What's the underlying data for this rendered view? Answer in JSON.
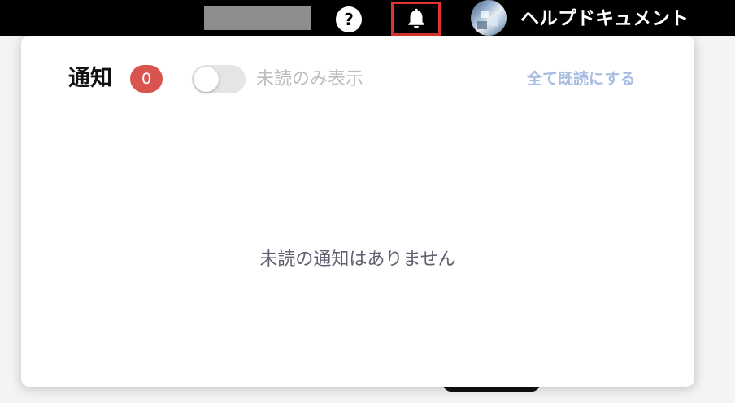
{
  "topbar": {
    "help_icon_glyph": "?",
    "help_icon": "question-circle-icon",
    "bell_icon": "bell-icon",
    "help_document_label": "ヘルプドキュメント",
    "highlight_color": "#e3342f"
  },
  "notifications": {
    "title": "通知",
    "count": "0",
    "badge_color": "#d9534f",
    "unread_only_label": "未読のみ表示",
    "unread_only_enabled": false,
    "mark_all_read_label": "全て既読にする",
    "mark_all_read_color": "#a9bde3",
    "empty_message": "未読の通知はありません"
  }
}
